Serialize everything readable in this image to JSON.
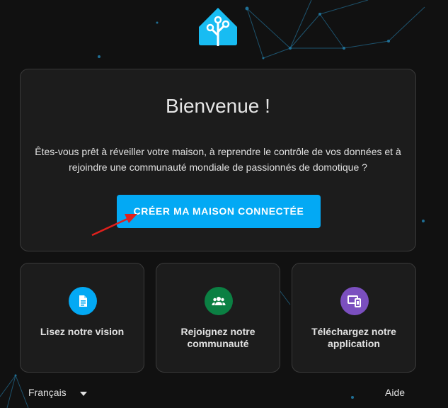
{
  "welcome": {
    "title": "Bienvenue !",
    "text": "Êtes-vous prêt à réveiller votre maison, à reprendre le contrôle de vos données et à rejoindre une communauté mondiale de passionnés de domotique ?",
    "cta_label": "CRÉER MA MAISON CONNECTÉE"
  },
  "cards": [
    {
      "label": "Lisez notre vision",
      "icon": "document-icon",
      "color": "#03a9f4"
    },
    {
      "label": "Rejoignez notre communauté",
      "icon": "community-icon",
      "color": "#0b8043"
    },
    {
      "label": "Téléchargez notre application",
      "icon": "devices-icon",
      "color": "#7b4fbf"
    }
  ],
  "footer": {
    "language": "Français",
    "help": "Aide"
  },
  "colors": {
    "accent": "#03a9f4",
    "background": "#111111",
    "card": "#1c1c1c",
    "annotation_arrow": "#e0201c"
  }
}
